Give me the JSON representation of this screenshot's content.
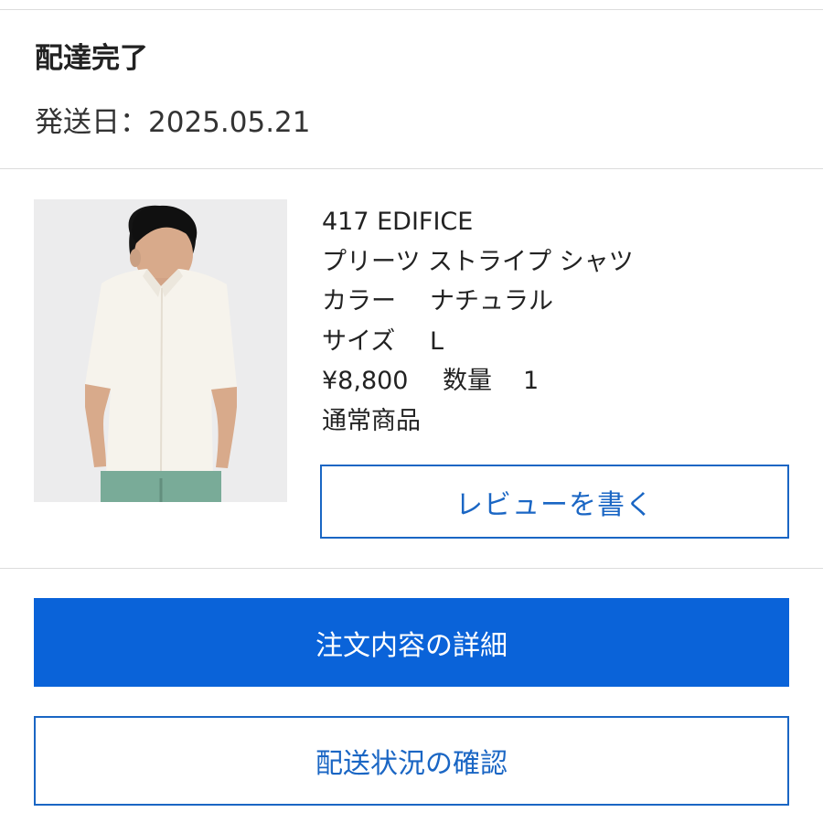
{
  "delivery": {
    "status": "配達完了",
    "ship_date_label": "発送日：",
    "ship_date": "2025.05.21"
  },
  "product": {
    "image_icon": "product-photo-shirt",
    "brand": "417 EDIFICE",
    "name": "プリーツ ストライプ シャツ",
    "color_label": "カラー",
    "color_value": "ナチュラル",
    "size_label": "サイズ",
    "size_value": "L",
    "price": "¥8,800",
    "quantity_label": "数量",
    "quantity_value": "1",
    "item_type": "通常商品"
  },
  "actions": {
    "review": "レビューを書く",
    "order_details": "注文内容の詳細",
    "shipping_status": "配送状況の確認"
  },
  "colors": {
    "accent_blue": "#0a63d9",
    "outline_blue": "#1a66c4",
    "divider": "#dcdcdc"
  }
}
